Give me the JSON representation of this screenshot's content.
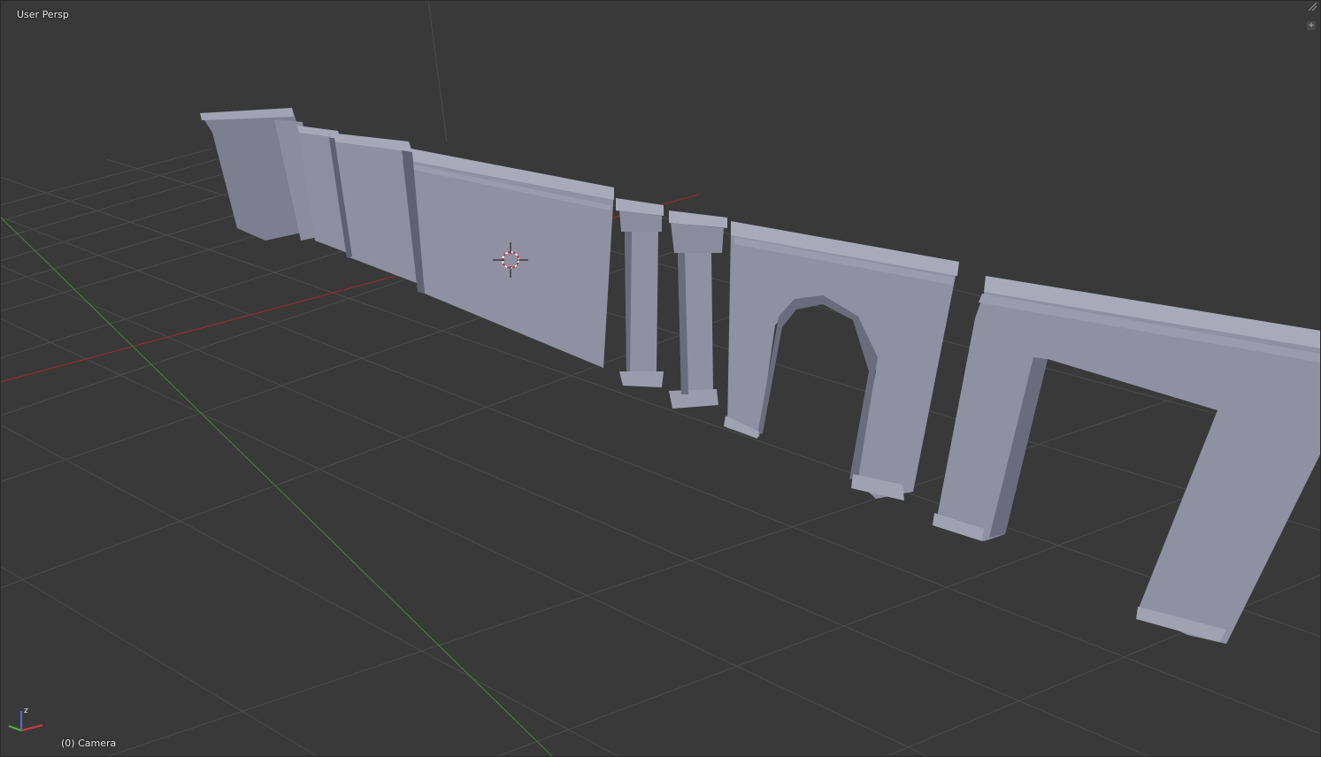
{
  "viewport": {
    "view_label": "User Persp",
    "object_label": "(0) Camera",
    "background": "#393939",
    "mesh_color": "#8c8e9f",
    "grid_color": "#4d4d4d",
    "x_axis_color": "#9e2b2b",
    "y_axis_color": "#3f8a2e"
  },
  "gizmo": {
    "z_label": "z",
    "icons": [
      "axis-x-icon",
      "axis-y-icon",
      "axis-z-icon"
    ]
  },
  "widgets": {
    "corner_icon": "area-split-icon",
    "toggle_icon": "plus-icon",
    "toggle_label": "+"
  }
}
